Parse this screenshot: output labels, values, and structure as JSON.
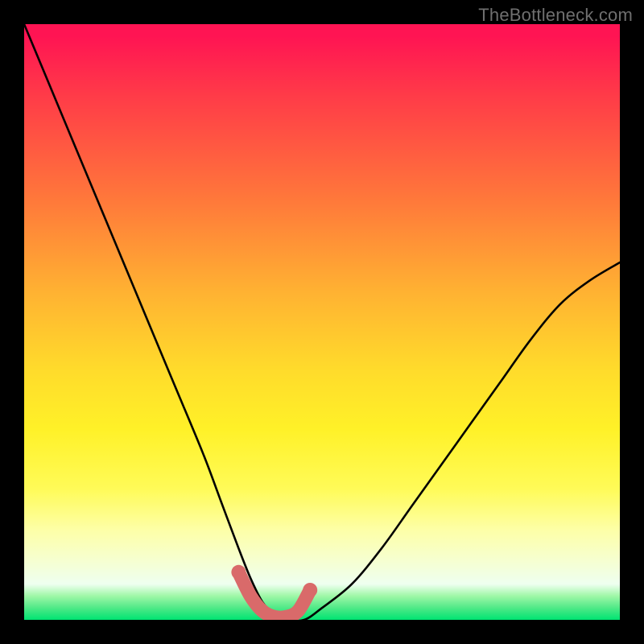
{
  "watermark": "TheBottleneck.com",
  "chart_data": {
    "type": "line",
    "title": "",
    "xlabel": "",
    "ylabel": "",
    "xlim": [
      0,
      100
    ],
    "ylim": [
      0,
      100
    ],
    "grid": false,
    "legend": false,
    "series": [
      {
        "name": "bottleneck-curve",
        "color": "#000000",
        "x": [
          0,
          5,
          10,
          15,
          20,
          25,
          30,
          33,
          36,
          38,
          40,
          42,
          44,
          47,
          50,
          55,
          60,
          65,
          70,
          75,
          80,
          85,
          90,
          95,
          100
        ],
        "y": [
          100,
          88,
          76,
          64,
          52,
          40,
          28,
          20,
          12,
          7,
          3,
          1,
          0,
          0,
          2,
          6,
          12,
          19,
          26,
          33,
          40,
          47,
          53,
          57,
          60
        ]
      }
    ],
    "highlight": {
      "name": "optimal-range",
      "color": "#d96a6a",
      "x": [
        36,
        38,
        40,
        42,
        44,
        46,
        48
      ],
      "y": [
        8,
        4,
        1.5,
        0.5,
        0.5,
        1.5,
        5
      ]
    },
    "gradient_stops": [
      {
        "pos": 0.0,
        "color": "#ff1453"
      },
      {
        "pos": 0.3,
        "color": "#ff7a3a"
      },
      {
        "pos": 0.58,
        "color": "#ffdb2b"
      },
      {
        "pos": 0.85,
        "color": "#fdffa8"
      },
      {
        "pos": 0.96,
        "color": "#9ff7a7"
      },
      {
        "pos": 1.0,
        "color": "#00e472"
      }
    ]
  }
}
